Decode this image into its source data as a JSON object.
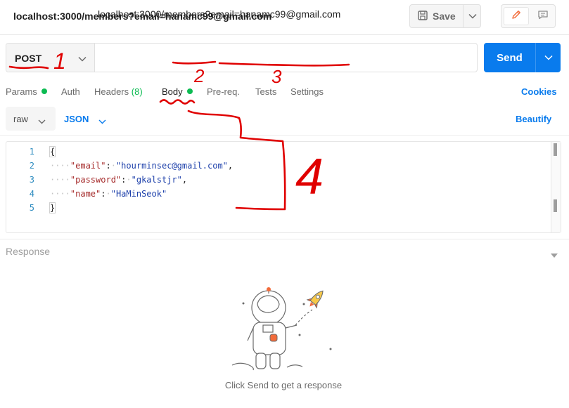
{
  "window": {
    "title": "localhost:3000/members?email=hanamc99@gmail.com",
    "save_label": "Save"
  },
  "request": {
    "method": "POST",
    "url": "localhost:3000/members?email=hanamc99@gmail.com",
    "send_label": "Send"
  },
  "tabs": [
    {
      "label": "Params",
      "indicator": true
    },
    {
      "label": "Auth",
      "indicator": false
    },
    {
      "label": "Headers",
      "count": "(8)"
    },
    {
      "label": "Body",
      "indicator": true,
      "active": true
    },
    {
      "label": "Pre-req.",
      "indicator": false
    },
    {
      "label": "Tests",
      "indicator": false
    },
    {
      "label": "Settings",
      "indicator": false
    }
  ],
  "cookies_label": "Cookies",
  "body": {
    "mode": "raw",
    "language": "JSON",
    "beautify_label": "Beautify",
    "line_numbers": [
      "1",
      "2",
      "3",
      "4",
      "5"
    ],
    "open_brace": "{",
    "close_brace": "}",
    "fields": [
      {
        "key": "\"email\"",
        "value": "\"hourminsec@gmail.com\"",
        "comma": ","
      },
      {
        "key": "\"password\"",
        "value": "\"gkalstjr\"",
        "comma": ","
      },
      {
        "key": "\"name\"",
        "value": "\"HaMinSeok\"",
        "comma": ""
      }
    ]
  },
  "response": {
    "label": "Response",
    "empty_message": "Click Send to get a response"
  },
  "annotations": [
    "1",
    "2",
    "3",
    "4"
  ],
  "colors": {
    "accent": "#097bed",
    "indicator": "#0cbb52",
    "annotation": "#e00000",
    "json_key": "#a52a2a",
    "json_string": "#1c3faa"
  },
  "icons": [
    "save-icon",
    "chevron-down-icon",
    "pencil-icon",
    "comment-icon",
    "astronaut-illustration"
  ]
}
